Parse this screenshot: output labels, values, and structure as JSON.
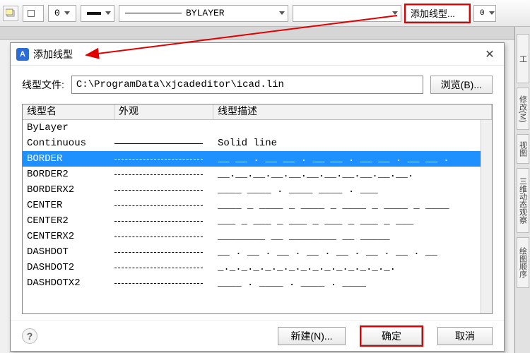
{
  "toolbar": {
    "zero_value": "0",
    "layer_combo": "BYLAYER",
    "add_linetype_btn": "添加线型...",
    "right_zero": "0"
  },
  "dialog": {
    "title": "添加线型",
    "file_label": "线型文件:",
    "file_path": "C:\\ProgramData\\xjcadeditor\\icad.lin",
    "browse_label": "浏览(B)...",
    "columns": {
      "name": "线型名",
      "appearance": "外观",
      "description": "线型描述"
    },
    "rows": [
      {
        "name": "ByLayer",
        "appearance": "",
        "desc": ""
      },
      {
        "name": "Continuous",
        "appearance": "solid",
        "desc": "Solid line"
      },
      {
        "name": "BORDER",
        "appearance": "dash",
        "desc": "__ __ . __ __ . __ __ . __ __ . __ __ .",
        "selected": true
      },
      {
        "name": "BORDER2",
        "appearance": "dash",
        "desc": "__.__.__.__.__.__.__.__.__.__.__."
      },
      {
        "name": "BORDERX2",
        "appearance": "dash",
        "desc": "____  ____  .  ____  ____  .  ___"
      },
      {
        "name": "CENTER",
        "appearance": "dash",
        "desc": "____ _ ____ _ ____ _ ____ _ ____ _ ____"
      },
      {
        "name": "CENTER2",
        "appearance": "dash",
        "desc": "___ _ ___ _ ___ _ ___ _ ___ _ ___"
      },
      {
        "name": "CENTERX2",
        "appearance": "dash",
        "desc": "________  __  ________  __  _____"
      },
      {
        "name": "DASHDOT",
        "appearance": "dash",
        "desc": "__ . __ . __ . __ . __ . __ . __ . __"
      },
      {
        "name": "DASHDOT2",
        "appearance": "dash",
        "desc": "_._._._._._._._._._._._._._._."
      },
      {
        "name": "DASHDOTX2",
        "appearance": "dash",
        "desc": "____  .  ____  .  ____  .  ____"
      }
    ],
    "buttons": {
      "new": "新建(N)...",
      "ok": "确定",
      "cancel": "取消"
    }
  },
  "side_tabs": [
    "工",
    "修改(M)",
    "视图",
    "三维动态观察",
    "绘图顺序"
  ]
}
